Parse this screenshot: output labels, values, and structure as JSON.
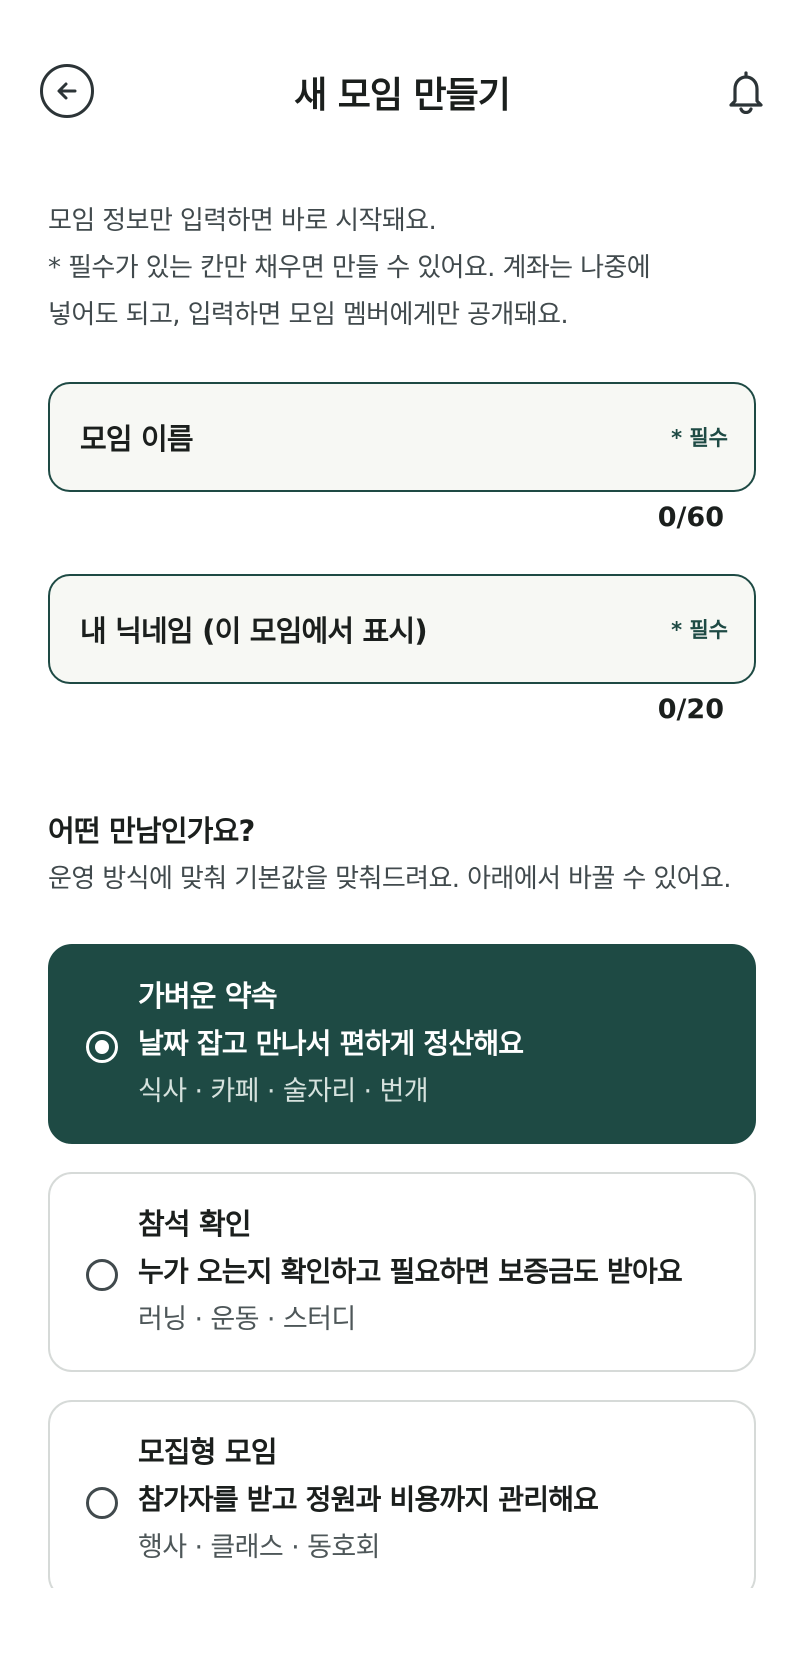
{
  "header": {
    "title": "새 모임 만들기",
    "back_icon": "arrow-left-circle-icon",
    "bell_icon": "bell-icon"
  },
  "intro": {
    "line1": "모임 정보만 입력하면 바로 시작돼요.",
    "line2": "* 필수가 있는 칸만 채우면 만들 수 있어요. 계좌는 나중에",
    "line3": "넣어도 되고, 입력하면 모임 멤버에게만 공개돼요."
  },
  "fields": {
    "group_name": {
      "label": "모임 이름",
      "required": "* 필수",
      "counter": "0/60"
    },
    "nickname": {
      "label": "내 닉네임 (이 모임에서 표시)",
      "required": "* 필수",
      "counter": "0/20"
    }
  },
  "meeting_type": {
    "title": "어떤 만남인가요?",
    "desc": "운영 방식에 맞춰 기본값을 맞춰드려요. 아래에서 바꿀 수 있어요.",
    "options": [
      {
        "name": "가벼운 약속",
        "desc": "날짜 잡고 만나서 편하게 정산해요",
        "tags": "식사 · 카페 · 술자리 · 번개",
        "selected": true
      },
      {
        "name": "참석 확인",
        "desc": "누가 오는지 확인하고 필요하면 보증금도 받아요",
        "tags": "러닝 · 운동 · 스터디",
        "selected": false
      },
      {
        "name": "모집형 모임",
        "desc": "참가자를 받고 정원과 비용까지 관리해요",
        "tags": "행사 · 클래스 · 동호회",
        "selected": false
      }
    ]
  },
  "colors": {
    "accent": "#1e4a44",
    "field_bg": "#f7f8f4",
    "muted_text": "#414a4d"
  }
}
